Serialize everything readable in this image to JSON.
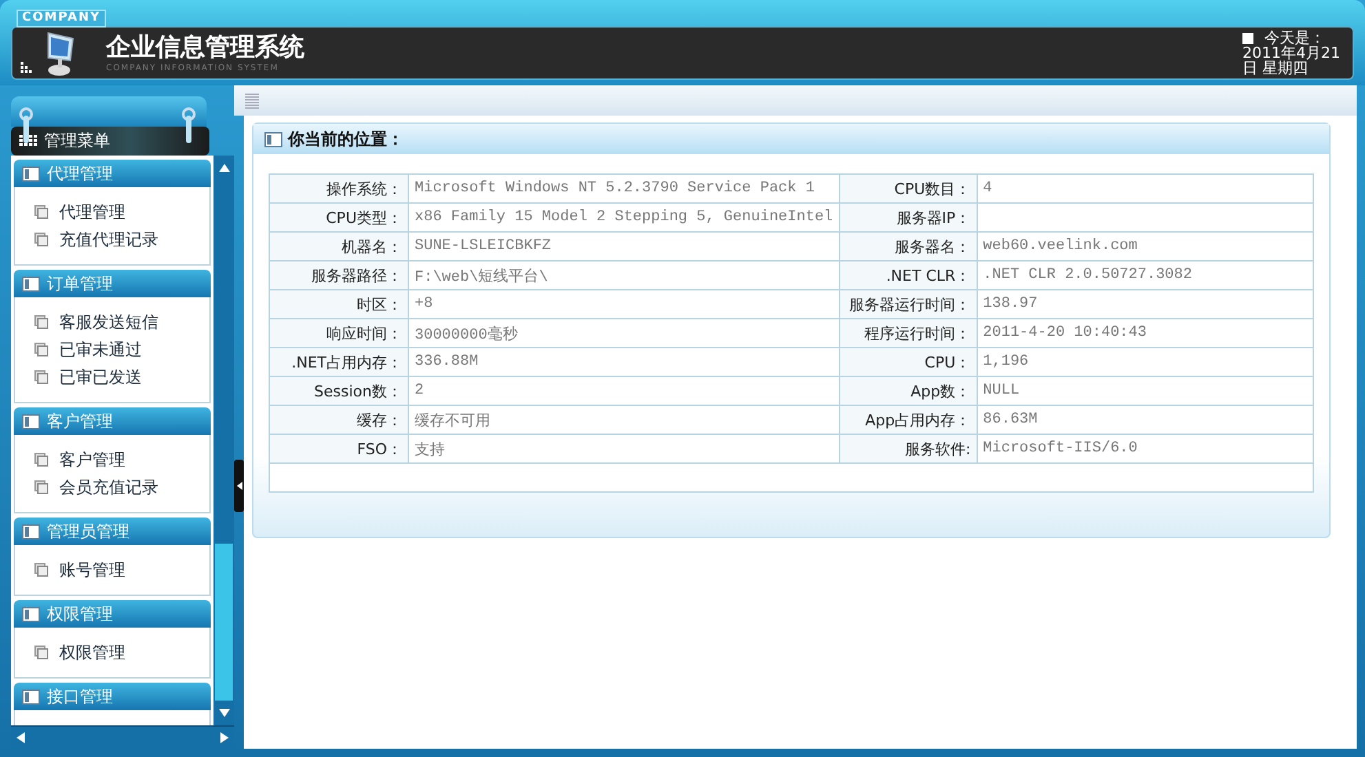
{
  "header": {
    "badge": "COMPANY",
    "title": "企业信息管理系统",
    "subtitle": "COMPANY INFORMATION SYSTEM",
    "today_label": "今天是：",
    "date": "2011年4月21日 星期四"
  },
  "sidebar": {
    "title": "管理菜单",
    "groups": [
      {
        "title": "代理管理",
        "items": [
          "代理管理",
          "充值代理记录"
        ]
      },
      {
        "title": "订单管理",
        "items": [
          "客服发送短信",
          "已审未通过",
          "已审已发送"
        ]
      },
      {
        "title": "客户管理",
        "items": [
          "客户管理",
          "会员充值记录"
        ]
      },
      {
        "title": "管理员管理",
        "items": [
          "账号管理"
        ]
      },
      {
        "title": "权限管理",
        "items": [
          "权限管理"
        ]
      },
      {
        "title": "接口管理"
      }
    ]
  },
  "content": {
    "title": "你当前的位置：",
    "rows": [
      {
        "label": "操作系统：",
        "value": "Microsoft Windows NT 5.2.3790 Service Pack 1",
        "label_2": "CPU数目：",
        "value_2": "4"
      },
      {
        "label": "CPU类型：",
        "value": "x86 Family 15 Model 2 Stepping 5, GenuineIntel",
        "label_2": "服务器IP："
      },
      {
        "label": "机器名：",
        "value": "SUNE-LSLEICBKFZ",
        "label_2": "服务器名：",
        "value_2": "web60.veelink.com"
      },
      {
        "label": "服务器路径：",
        "value": "F:\\web\\短线平台\\",
        "label_2": ".NET CLR：",
        "value_2": ".NET CLR 2.0.50727.3082"
      },
      {
        "label": "时区：",
        "value": "+8",
        "label_2": "服务器运行时间：",
        "value_2": "138.97"
      },
      {
        "label": "响应时间：",
        "value": "30000000毫秒",
        "label_2": "程序运行时间：",
        "value_2": "2011-4-20 10:40:43"
      },
      {
        "label": ".NET占用内存：",
        "value": "336.88M",
        "label_2": "CPU：",
        "value_2": "1,196"
      },
      {
        "label": "Session数：",
        "value": "2",
        "label_2": "App数：",
        "value_2": "NULL"
      },
      {
        "label": "缓存：",
        "value": "缓存不可用",
        "label_2": "App占用内存：",
        "value_2": "86.63M"
      },
      {
        "label": "FSO：",
        "value": "支持",
        "label_2": "服务软件:",
        "value_2": "Microsoft-IIS/6.0"
      }
    ]
  }
}
